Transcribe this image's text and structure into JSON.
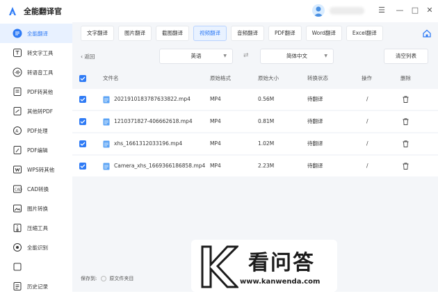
{
  "app": {
    "title": "全能翻译官"
  },
  "window_controls": {
    "menu": "☰",
    "minimize": "—",
    "maximize": "□",
    "close": "✕"
  },
  "sidebar": {
    "items": [
      {
        "label": "全能翻译",
        "icon": "translate-icon",
        "active": true
      },
      {
        "label": "转文字工具",
        "icon": "text-tool-icon"
      },
      {
        "label": "转语音工具",
        "icon": "voice-tool-icon"
      },
      {
        "label": "PDF转其他",
        "icon": "pdf-convert-icon"
      },
      {
        "label": "其他转PDF",
        "icon": "to-pdf-icon"
      },
      {
        "label": "PDF处理",
        "icon": "pdf-process-icon"
      },
      {
        "label": "PDF编辑",
        "icon": "pdf-edit-icon"
      },
      {
        "label": "WPS转其他",
        "icon": "wps-icon"
      },
      {
        "label": "CAD转换",
        "icon": "cad-icon"
      },
      {
        "label": "图片转换",
        "icon": "image-convert-icon"
      },
      {
        "label": "压缩工具",
        "icon": "compress-icon"
      },
      {
        "label": "全能识别",
        "icon": "recognize-icon"
      },
      {
        "label": "",
        "icon": "partial-icon"
      },
      {
        "label": "历史记录",
        "icon": "history-icon"
      }
    ]
  },
  "tabs": [
    {
      "label": "文字翻译"
    },
    {
      "label": "图片翻译"
    },
    {
      "label": "截图翻译"
    },
    {
      "label": "视频翻译",
      "active": true
    },
    {
      "label": "音频翻译"
    },
    {
      "label": "PDF翻译"
    },
    {
      "label": "Word翻译"
    },
    {
      "label": "Excel翻译"
    }
  ],
  "toolbar": {
    "back": "返回",
    "source_lang": "英语",
    "target_lang": "简体中文",
    "clear_list": "清空列表",
    "swap_icon": "⇄"
  },
  "table": {
    "headers": [
      "文件名",
      "原始格式",
      "原始大小",
      "转换状态",
      "操作",
      "删除"
    ],
    "rows": [
      {
        "name": "20219101837876338​22.mp4",
        "format": "MP4",
        "size": "0.56M",
        "status": "待翻译",
        "action": "/"
      },
      {
        "name": "1210371827-406662618.mp4",
        "format": "MP4",
        "size": "0.81M",
        "status": "待翻译",
        "action": "/"
      },
      {
        "name": "xhs_1661312033196.mp4",
        "format": "MP4",
        "size": "1.02M",
        "status": "待翻译",
        "action": "/"
      },
      {
        "name": "Camera_xhs_1669366186858.mp4",
        "format": "MP4",
        "size": "2.23M",
        "status": "待翻译",
        "action": "/"
      }
    ]
  },
  "footer": {
    "save_to": "保存到:",
    "option": "原文件夹目"
  },
  "watermark": {
    "text": "看问答",
    "url": "www.kanwenda.com"
  },
  "colors": {
    "accent": "#2f7bf5",
    "content_bg": "#f4f6f9"
  }
}
